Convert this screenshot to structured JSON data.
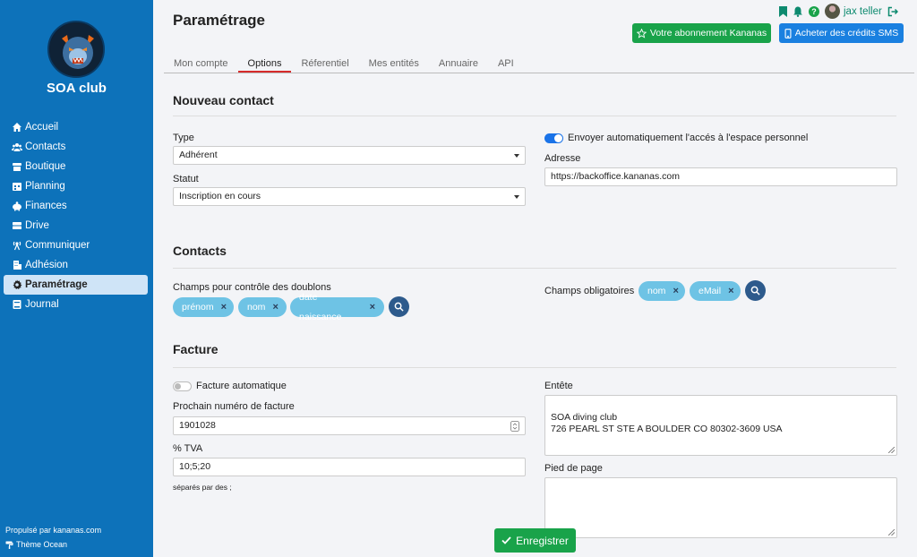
{
  "sidebar": {
    "club_name": "SOA club",
    "items": [
      {
        "label": "Accueil",
        "icon": "home-icon"
      },
      {
        "label": "Contacts",
        "icon": "users-icon"
      },
      {
        "label": "Boutique",
        "icon": "shop-icon"
      },
      {
        "label": "Planning",
        "icon": "calendar-icon"
      },
      {
        "label": "Finances",
        "icon": "piggy-bank-icon"
      },
      {
        "label": "Drive",
        "icon": "drive-icon"
      },
      {
        "label": "Communiquer",
        "icon": "broadcast-icon"
      },
      {
        "label": "Adhésion",
        "icon": "building-icon"
      },
      {
        "label": "Paramétrage",
        "icon": "gear-icon",
        "active": true
      },
      {
        "label": "Journal",
        "icon": "book-icon"
      }
    ],
    "powered_by": "Propulsé par kananas.com",
    "theme": "Thème Ocean"
  },
  "header": {
    "title": "Paramétrage",
    "user_name": "jax teller",
    "subscription_label": "Votre abonnement Kananas",
    "sms_label": "Acheter des crédits SMS"
  },
  "tabs": [
    {
      "label": "Mon compte"
    },
    {
      "label": "Options",
      "active": true
    },
    {
      "label": "Réferentiel"
    },
    {
      "label": "Mes entités"
    },
    {
      "label": "Annuaire"
    },
    {
      "label": "API"
    }
  ],
  "nouveau_contact": {
    "title": "Nouveau contact",
    "type_label": "Type",
    "type_value": "Adhérent",
    "statut_label": "Statut",
    "statut_value": "Inscription en cours",
    "send_access_label": "Envoyer automatiquement l'accés à l'espace personnel",
    "send_access_on": true,
    "adresse_label": "Adresse",
    "adresse_value": "https://backoffice.kananas.com"
  },
  "contacts": {
    "title": "Contacts",
    "doublons_label": "Champs pour contrôle des doublons",
    "doublons_tags": [
      "prénom",
      "nom",
      "date naissance"
    ],
    "obligatoires_label": "Champs obligatoires",
    "obligatoires_tags": [
      "nom",
      "eMail"
    ]
  },
  "facture": {
    "title": "Facture",
    "auto_label": "Facture automatique",
    "auto_on": false,
    "prochain_label": "Prochain numéro de facture",
    "prochain_value": "1901028",
    "tva_label": "% TVA",
    "tva_value": "10;5;20",
    "tva_hint": "séparés par des ;",
    "entete_label": "Entête",
    "entete_value": "SOA diving club\n726 PEARL ST STE A BOULDER CO 80302-3609 USA",
    "pied_label": "Pied de page",
    "pied_value": ""
  },
  "save_label": "Enregistrer",
  "colors": {
    "sidebar": "#0d72ba",
    "green": "#19a34a",
    "blue": "#1a80e0",
    "tag": "#6ec3e5",
    "tab_active": "#d62b2b"
  }
}
